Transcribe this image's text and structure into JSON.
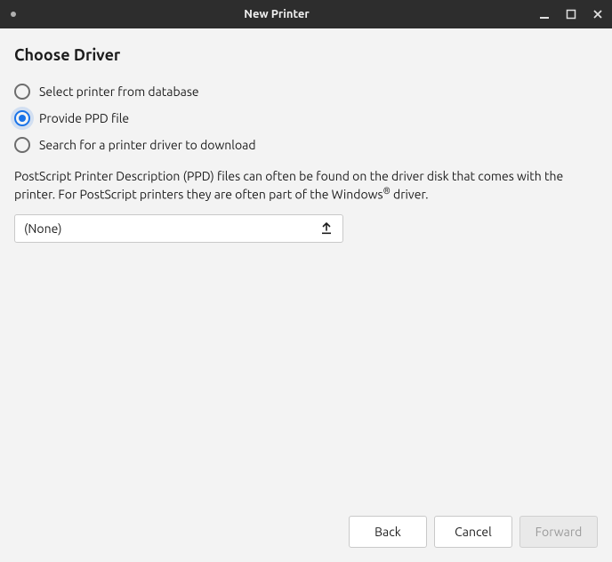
{
  "window": {
    "title": "New Printer"
  },
  "heading": "Choose Driver",
  "options": {
    "select_db": "Select printer from database",
    "provide_ppd": "Provide PPD file",
    "search_download": "Search for a printer driver to download",
    "selected": "provide_ppd"
  },
  "description": {
    "pre": "PostScript Printer Description (PPD) files can often be found on the driver disk that comes with the printer. For PostScript printers they are often part of the Windows",
    "post": " driver."
  },
  "file_chooser": {
    "value": "(None)"
  },
  "buttons": {
    "back": "Back",
    "cancel": "Cancel",
    "forward": "Forward"
  }
}
